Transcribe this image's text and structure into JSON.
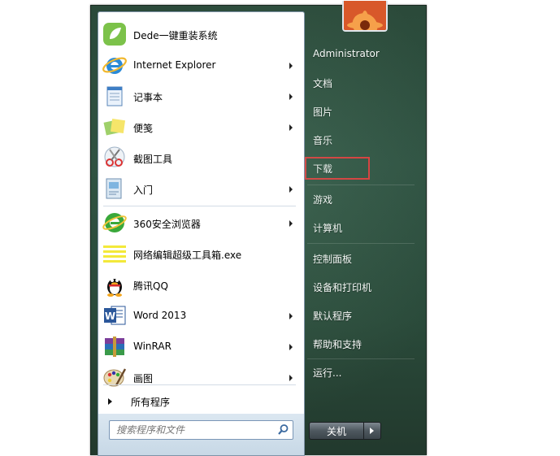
{
  "programs": [
    {
      "label": "Dede一键重装系统",
      "icon": "dede-app-icon",
      "submenu": false
    },
    {
      "label": "Internet Explorer",
      "icon": "internet-explorer-icon",
      "submenu": true
    },
    {
      "label": "记事本",
      "icon": "notepad-icon",
      "submenu": true
    },
    {
      "label": "便笺",
      "icon": "sticky-notes-icon",
      "submenu": true
    },
    {
      "label": "截图工具",
      "icon": "snipping-tool-icon",
      "submenu": false
    },
    {
      "label": "入门",
      "icon": "getting-started-icon",
      "submenu": true
    },
    {
      "label": "360安全浏览器",
      "icon": "360-browser-icon",
      "submenu": true
    },
    {
      "label": "网络编辑超级工具箱.exe",
      "icon": "exe-app-icon",
      "submenu": false
    },
    {
      "label": "腾讯QQ",
      "icon": "qq-penguin-icon",
      "submenu": false
    },
    {
      "label": "Word 2013",
      "icon": "word-icon",
      "submenu": true
    },
    {
      "label": "WinRAR",
      "icon": "winrar-icon",
      "submenu": true
    },
    {
      "label": "画图",
      "icon": "paint-icon",
      "submenu": true
    }
  ],
  "all_programs": "所有程序",
  "search": {
    "placeholder": "搜索程序和文件"
  },
  "right_items": [
    {
      "label": "Administrator",
      "name": "user-name"
    },
    {
      "label": "文档",
      "name": "documents"
    },
    {
      "label": "图片",
      "name": "pictures"
    },
    {
      "label": "音乐",
      "name": "music"
    },
    {
      "label": "下载",
      "name": "downloads",
      "highlighted": true
    },
    {
      "label": "游戏",
      "name": "games"
    },
    {
      "label": "计算机",
      "name": "computer"
    },
    {
      "label": "控制面板",
      "name": "control-panel"
    },
    {
      "label": "设备和打印机",
      "name": "devices-and-printers"
    },
    {
      "label": "默认程序",
      "name": "default-programs"
    },
    {
      "label": "帮助和支持",
      "name": "help-and-support"
    },
    {
      "label": "运行...",
      "name": "run"
    }
  ],
  "shutdown": {
    "label": "关机"
  },
  "colors": {
    "highlight_border": "#e0393a",
    "menu_background": "#2f5242"
  }
}
